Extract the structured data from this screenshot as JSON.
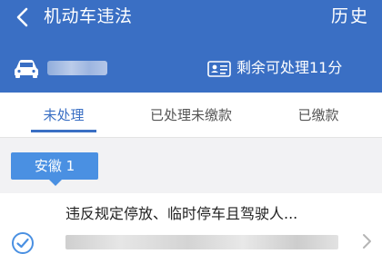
{
  "header": {
    "title": "机动车违法",
    "history_label": "历史",
    "remaining_text": "剩余可处理11分"
  },
  "tabs": [
    {
      "label": "未处理",
      "active": true
    },
    {
      "label": "已处理未缴款",
      "active": false
    },
    {
      "label": "已缴款",
      "active": false
    }
  ],
  "group": {
    "badge": "安徽 1"
  },
  "violations": [
    {
      "title": "违反规定停放、临时停车且驾驶人..."
    }
  ],
  "colors": {
    "brand": "#3a6fc4",
    "badge": "#4a90e2"
  },
  "icons": {
    "back": "chevron-left-icon",
    "car": "car-icon",
    "card": "id-card-icon",
    "check": "check-circle-icon",
    "next": "chevron-right-icon"
  }
}
